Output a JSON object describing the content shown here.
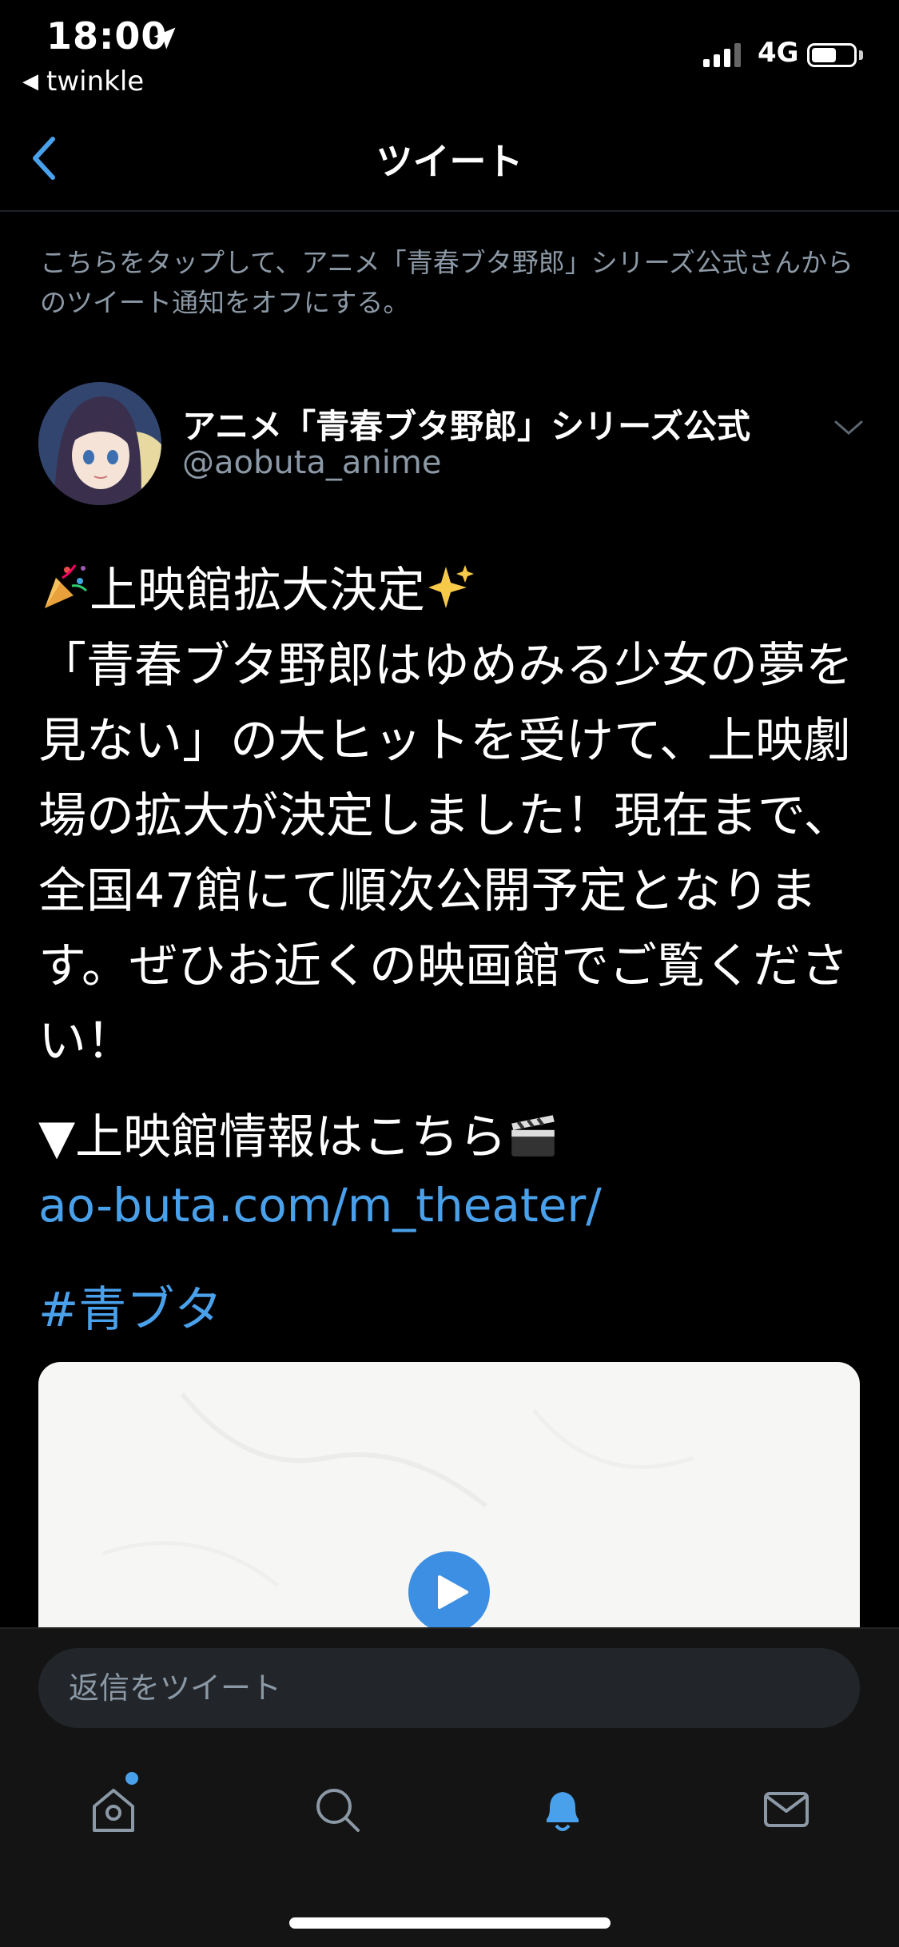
{
  "status_bar": {
    "time": "18:00",
    "back_app": "twinkle",
    "network": "4G",
    "battery_level": 0.6
  },
  "nav": {
    "title": "ツイート"
  },
  "notice": "こちらをタップして、アニメ「青春ブタ野郎」シリーズ公式さんからのツイート通知をオフにする。",
  "author": {
    "display_name": "アニメ「青春ブタ野郎」シリーズ公式",
    "handle": "@aobuta_anime"
  },
  "tweet": {
    "line1": "上映館拡大決定",
    "body": "「青春ブタ野郎はゆめみる少女の夢を見ない」の大ヒットを受けて、上映劇場の拡大が決定しました！現在まで、全国47館にて順次公開予定となります。ぜひお近くの映画館でご覧ください！",
    "info_line": "▼上映館情報はこちら",
    "link": "ao-buta.com/m_theater/",
    "hashtag": "#青ブタ"
  },
  "reply": {
    "placeholder": "返信をツイート"
  },
  "tabs": [
    "home-icon",
    "search-icon",
    "bell-icon",
    "mail-icon"
  ],
  "colors": {
    "accent": "#4aa1eb",
    "secondary_text": "#8b98a5",
    "background": "#000000"
  }
}
